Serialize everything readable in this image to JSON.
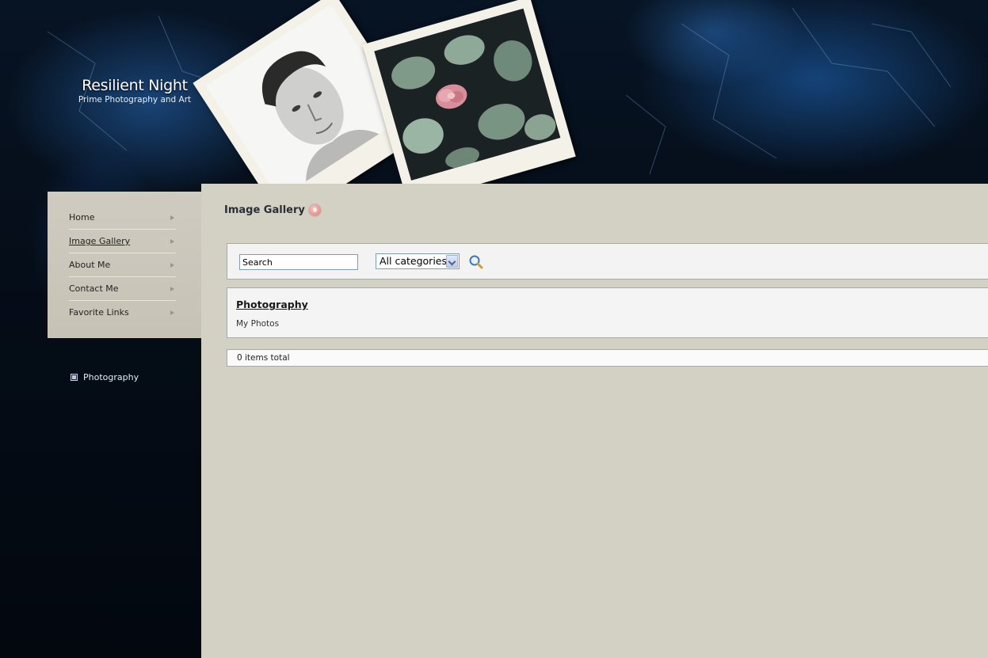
{
  "site": {
    "title": "Resilient Night",
    "tagline": "Prime Photography and Art"
  },
  "nav": {
    "items": [
      {
        "label": "Home",
        "active": false
      },
      {
        "label": "Image Gallery",
        "active": true
      },
      {
        "label": "About Me",
        "active": false
      },
      {
        "label": "Contact Me",
        "active": false
      },
      {
        "label": "Favorite Links",
        "active": false
      }
    ]
  },
  "categories_sidebar": {
    "items": [
      {
        "label": "Photography",
        "icon": "square-bullet-icon"
      }
    ]
  },
  "main": {
    "title": "Image Gallery",
    "rss_icon": "rss-icon",
    "search": {
      "input_value": "Search",
      "category_selected": "All categories",
      "button_icon": "magnifier-icon"
    },
    "category": {
      "name": "Photography",
      "description": "My Photos"
    },
    "total": "0 items total"
  },
  "colors": {
    "background": "#050c16",
    "accent_blue": "#1e5aa0",
    "panel": "#d3d0c4",
    "sidebar_panel": "#cbc7bb"
  }
}
